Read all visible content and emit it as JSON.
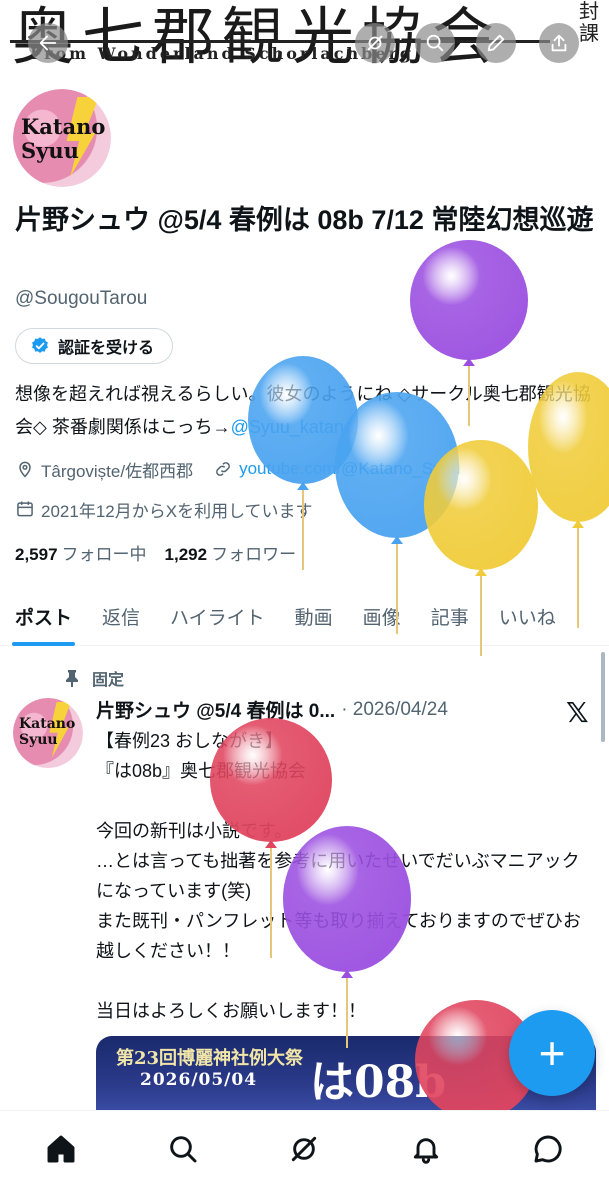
{
  "banner": {
    "title": "奥七郡観光協会",
    "subtitle": "From Wonderland Schorlachberg",
    "side_text": "封\n課"
  },
  "header_icons": [
    "back-arrow-icon",
    "grok-icon",
    "search-icon",
    "edit-icon",
    "share-icon"
  ],
  "avatar": {
    "text_line1": "Katano",
    "text_line2": "Syuu"
  },
  "profile": {
    "display_name": "片野シュウ @5/4 春例は 08b 7/12 常陸幻想巡遊",
    "handle": "@SougouTarou",
    "verify_label": "認証を受ける",
    "bio_text": "想像を超えれば視えるらしい。彼女のようにね ◇サークル奥七郡観光協会◇ 茶番劇関係はこっち→",
    "bio_link": "@Syuu_katano",
    "location": "Târgoviște/佐都西郡",
    "website": "youtube.com/@Katano_Syuu",
    "joined": "2021年12月からXを利用しています",
    "following_count": "2,597",
    "following_label": "フォロー中",
    "followers_count": "1,292",
    "followers_label": "フォロワー"
  },
  "tabs": [
    {
      "label": "ポスト",
      "active": true
    },
    {
      "label": "返信",
      "active": false
    },
    {
      "label": "ハイライト",
      "active": false
    },
    {
      "label": "動画",
      "active": false
    },
    {
      "label": "画像",
      "active": false
    },
    {
      "label": "記事",
      "active": false
    },
    {
      "label": "いいね",
      "active": false
    }
  ],
  "tweet": {
    "pinned_label": "固定",
    "author": "片野シュウ @5/4 春例は 0...",
    "date": "2026/04/24",
    "body": "【春例23 おしながき】\n『は08b』奥七郡観光協会\n\n今回の新刊は小説です。\n…とは言っても拙著を参考に用いたせいでだいぶマニアックになっています(笑)\nまた既刊・パンフレット等も取り揃えておりますのでぜひお越しください！！\n\n当日はよろしくお願いします！！",
    "media_line1": "第23回博麗神社例大祭",
    "media_line2": "2026/05/04",
    "media_big": "は08b"
  },
  "fab_label": "+",
  "colors": {
    "accent": "#1d9bf0",
    "text": "#0f1419",
    "muted": "#536471"
  }
}
